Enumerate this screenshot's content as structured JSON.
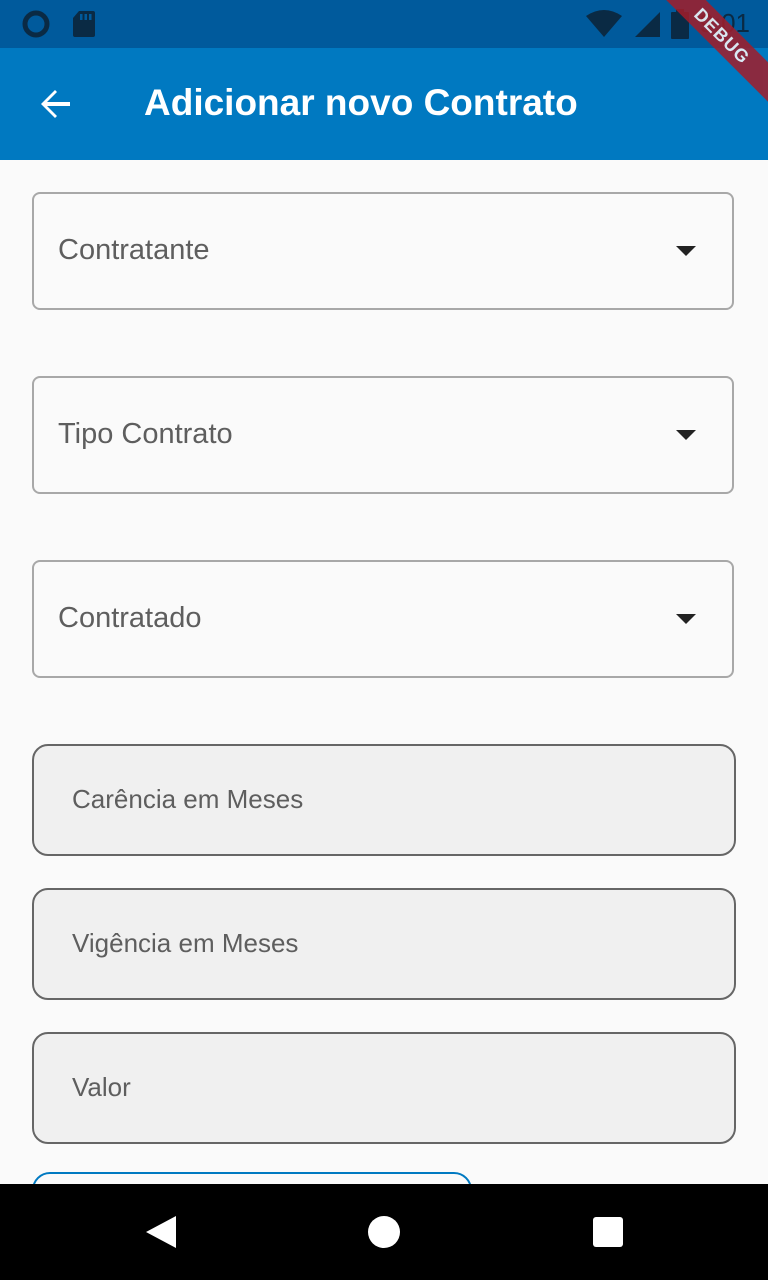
{
  "status_bar": {
    "time": "9:01",
    "icons": [
      "circle-status-icon",
      "sd-card-icon",
      "wifi-icon",
      "signal-icon",
      "battery-icon"
    ]
  },
  "debug_banner": "DEBUG",
  "app_bar": {
    "title": "Adicionar novo Contrato",
    "back_icon": "arrow-back-icon"
  },
  "form": {
    "dropdowns": [
      {
        "label": "Contratante"
      },
      {
        "label": "Tipo Contrato"
      },
      {
        "label": "Contratado"
      }
    ],
    "fields": [
      {
        "placeholder": "Carência em Meses"
      },
      {
        "placeholder": "Vigência em Meses"
      },
      {
        "placeholder": "Valor"
      }
    ]
  },
  "nav_bar": {
    "icons": [
      "nav-back-icon",
      "nav-home-icon",
      "nav-recents-icon"
    ]
  },
  "colors": {
    "status_bar": "#005a9c",
    "app_bar": "#0079c1",
    "background": "#fafafa",
    "field_fill": "#f0f0f0"
  }
}
